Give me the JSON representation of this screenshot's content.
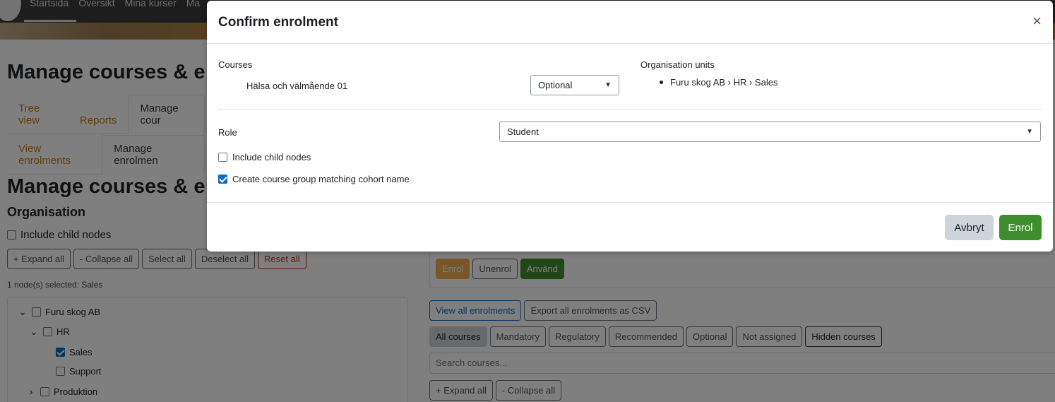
{
  "background": {
    "nav": [
      "Startsida",
      "Översikt",
      "Mina kurser",
      "Ma"
    ],
    "heading": "Manage courses & e",
    "tabs_top": [
      "Tree view",
      "Reports",
      "Manage cour"
    ],
    "tabs_second": [
      "View enrolments",
      "Manage enrolmen"
    ],
    "heading2": "Manage courses & e",
    "org_title": "Organisation",
    "include_child_nodes": "Include child nodes",
    "tree_buttons": [
      "+ Expand all",
      "- Collapse all",
      "Select all",
      "Deselect all",
      "Reset all"
    ],
    "nodes_selected": "1 node(s) selected: Sales",
    "tree": {
      "root": "Furu skog AB",
      "hr": "HR",
      "sales": "Sales",
      "support": "Support",
      "produktion": "Produktion"
    },
    "action_buttons": [
      "Enrol",
      "Unenrol",
      "Använd"
    ],
    "view_all": "View all enrolments",
    "export_csv": "Export all enrolments as CSV",
    "filters": [
      "All courses",
      "Mandatory",
      "Regulatory",
      "Recommended",
      "Optional",
      "Not assigned",
      "Hidden courses"
    ],
    "search_placeholder": "Search courses...",
    "course_buttons": [
      "+ Expand all",
      "- Collapse all"
    ]
  },
  "modal": {
    "title": "Confirm enrolment",
    "close_symbol": "×",
    "courses_label": "Courses",
    "course_name": "Hälsa och välmående 01",
    "course_type_selected": "Optional",
    "org_units_label": "Organisation units",
    "org_unit_path": "Furu skog AB › HR › Sales",
    "role_label": "Role",
    "role_selected": "Student",
    "include_child_nodes": "Include child nodes",
    "include_child_nodes_checked": false,
    "create_group": "Create course group matching cohort name",
    "create_group_checked": true,
    "cancel_button": "Avbryt",
    "enrol_button": "Enrol"
  },
  "colors": {
    "accent_orange": "#c57d10",
    "enrol_green": "#3e8e2e",
    "checkbox_blue": "#0f6cbf",
    "reset_red": "#ca3120"
  }
}
